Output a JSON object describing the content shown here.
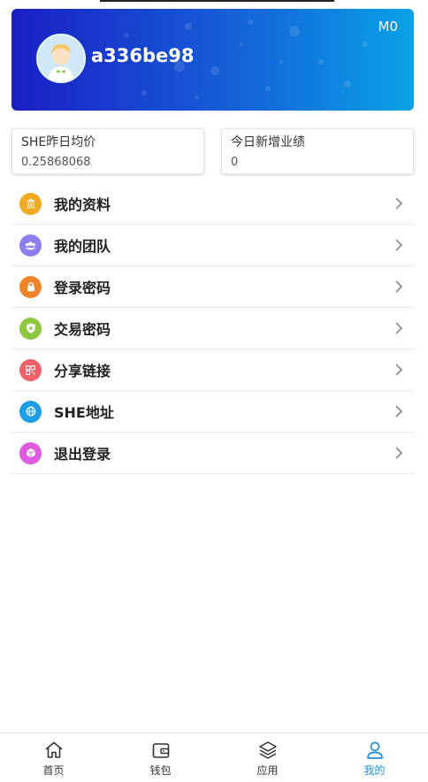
{
  "header": {
    "level": "M0",
    "username": "a336be98"
  },
  "stats": [
    {
      "title": "SHE昨日均价",
      "value": "0.25868068"
    },
    {
      "title": "今日新增业绩",
      "value": "0"
    }
  ],
  "menu": [
    {
      "label": "我的资料",
      "icon": "bank-icon",
      "color": "#f0a81e"
    },
    {
      "label": "我的团队",
      "icon": "team-icon",
      "color": "#8a7ef0"
    },
    {
      "label": "登录密码",
      "icon": "lock-icon",
      "color": "#f0842a"
    },
    {
      "label": "交易密码",
      "icon": "shield-icon",
      "color": "#8dc63f"
    },
    {
      "label": "分享链接",
      "icon": "qrcode-icon",
      "color": "#f0616a"
    },
    {
      "label": "SHE地址",
      "icon": "globe-icon",
      "color": "#1e9de8"
    },
    {
      "label": "退出登录",
      "icon": "cube-icon",
      "color": "#e05adf"
    }
  ],
  "tabbar": [
    {
      "label": "首页",
      "icon": "home-icon"
    },
    {
      "label": "钱包",
      "icon": "wallet-icon"
    },
    {
      "label": "应用",
      "icon": "layers-icon"
    },
    {
      "label": "我的",
      "icon": "user-icon",
      "active": true
    }
  ],
  "colors": {
    "accent": "#1e90d8",
    "header_start": "#1a1fc4",
    "header_end": "#0aa2e6"
  }
}
